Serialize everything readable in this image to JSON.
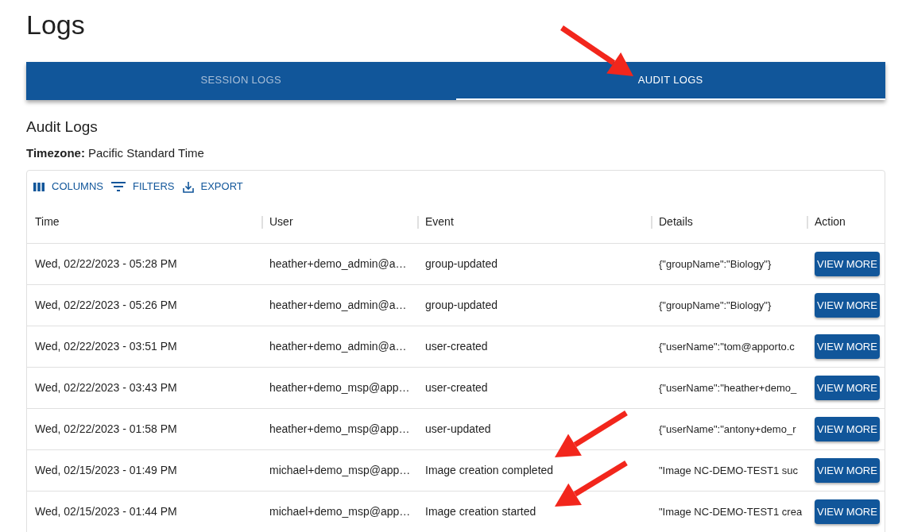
{
  "page_title": "Logs",
  "tabs": [
    {
      "label": "SESSION LOGS",
      "selected": false
    },
    {
      "label": "AUDIT LOGS",
      "selected": true
    }
  ],
  "section_title": "Audit Logs",
  "timezone": {
    "label": "Timezone:",
    "value": "Pacific Standard Time"
  },
  "toolbar": [
    {
      "kind": "columns",
      "label": "COLUMNS"
    },
    {
      "kind": "filters",
      "label": "FILTERS"
    },
    {
      "kind": "export",
      "label": "EXPORT"
    }
  ],
  "table": {
    "columns": [
      "Time",
      "User",
      "Event",
      "Details",
      "Action"
    ],
    "rows": [
      {
        "time": "Wed, 02/22/2023 - 05:28 PM",
        "user": "heather+demo_admin@a…",
        "event": "group-updated",
        "details": "{\"groupName\":\"Biology\"}",
        "action": "VIEW MORE"
      },
      {
        "time": "Wed, 02/22/2023 - 05:26 PM",
        "user": "heather+demo_admin@a…",
        "event": "group-updated",
        "details": "{\"groupName\":\"Biology\"}",
        "action": "VIEW MORE"
      },
      {
        "time": "Wed, 02/22/2023 - 03:51 PM",
        "user": "heather+demo_admin@a…",
        "event": "user-created",
        "details": "{\"userName\":\"tom@apporto.c",
        "action": "VIEW MORE"
      },
      {
        "time": "Wed, 02/22/2023 - 03:43 PM",
        "user": "heather+demo_msp@app…",
        "event": "user-created",
        "details": "{\"userName\":\"heather+demo_",
        "action": "VIEW MORE"
      },
      {
        "time": "Wed, 02/22/2023 - 01:58 PM",
        "user": "heather+demo_msp@app…",
        "event": "user-updated",
        "details": "{\"userName\":\"antony+demo_r",
        "action": "VIEW MORE"
      },
      {
        "time": "Wed, 02/15/2023 - 01:49 PM",
        "user": "michael+demo_msp@app…",
        "event": "Image creation completed",
        "details": "\"Image NC-DEMO-TEST1 suc",
        "action": "VIEW MORE"
      },
      {
        "time": "Wed, 02/15/2023 - 01:44 PM",
        "user": "michael+demo_msp@app…",
        "event": "Image creation started",
        "details": "\"Image NC-DEMO-TEST1 crea",
        "action": "VIEW MORE"
      }
    ]
  }
}
